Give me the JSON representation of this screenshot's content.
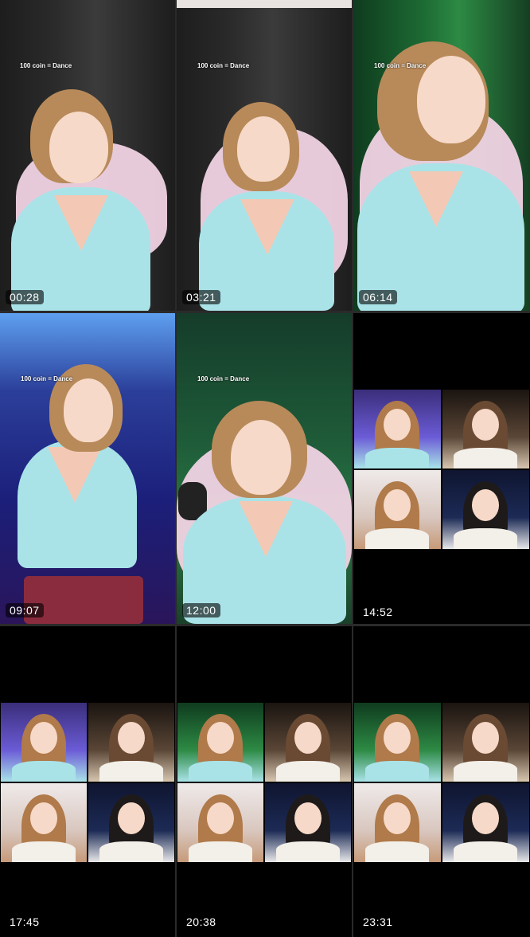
{
  "overlay_caption": "100 coin = Dance",
  "tiles": [
    {
      "time": "00:28"
    },
    {
      "time": "03:21"
    },
    {
      "time": "06:14"
    },
    {
      "time": "09:07"
    },
    {
      "time": "12:00"
    },
    {
      "time": "14:52"
    },
    {
      "time": "17:45"
    },
    {
      "time": "20:38"
    },
    {
      "time": "23:31"
    }
  ]
}
